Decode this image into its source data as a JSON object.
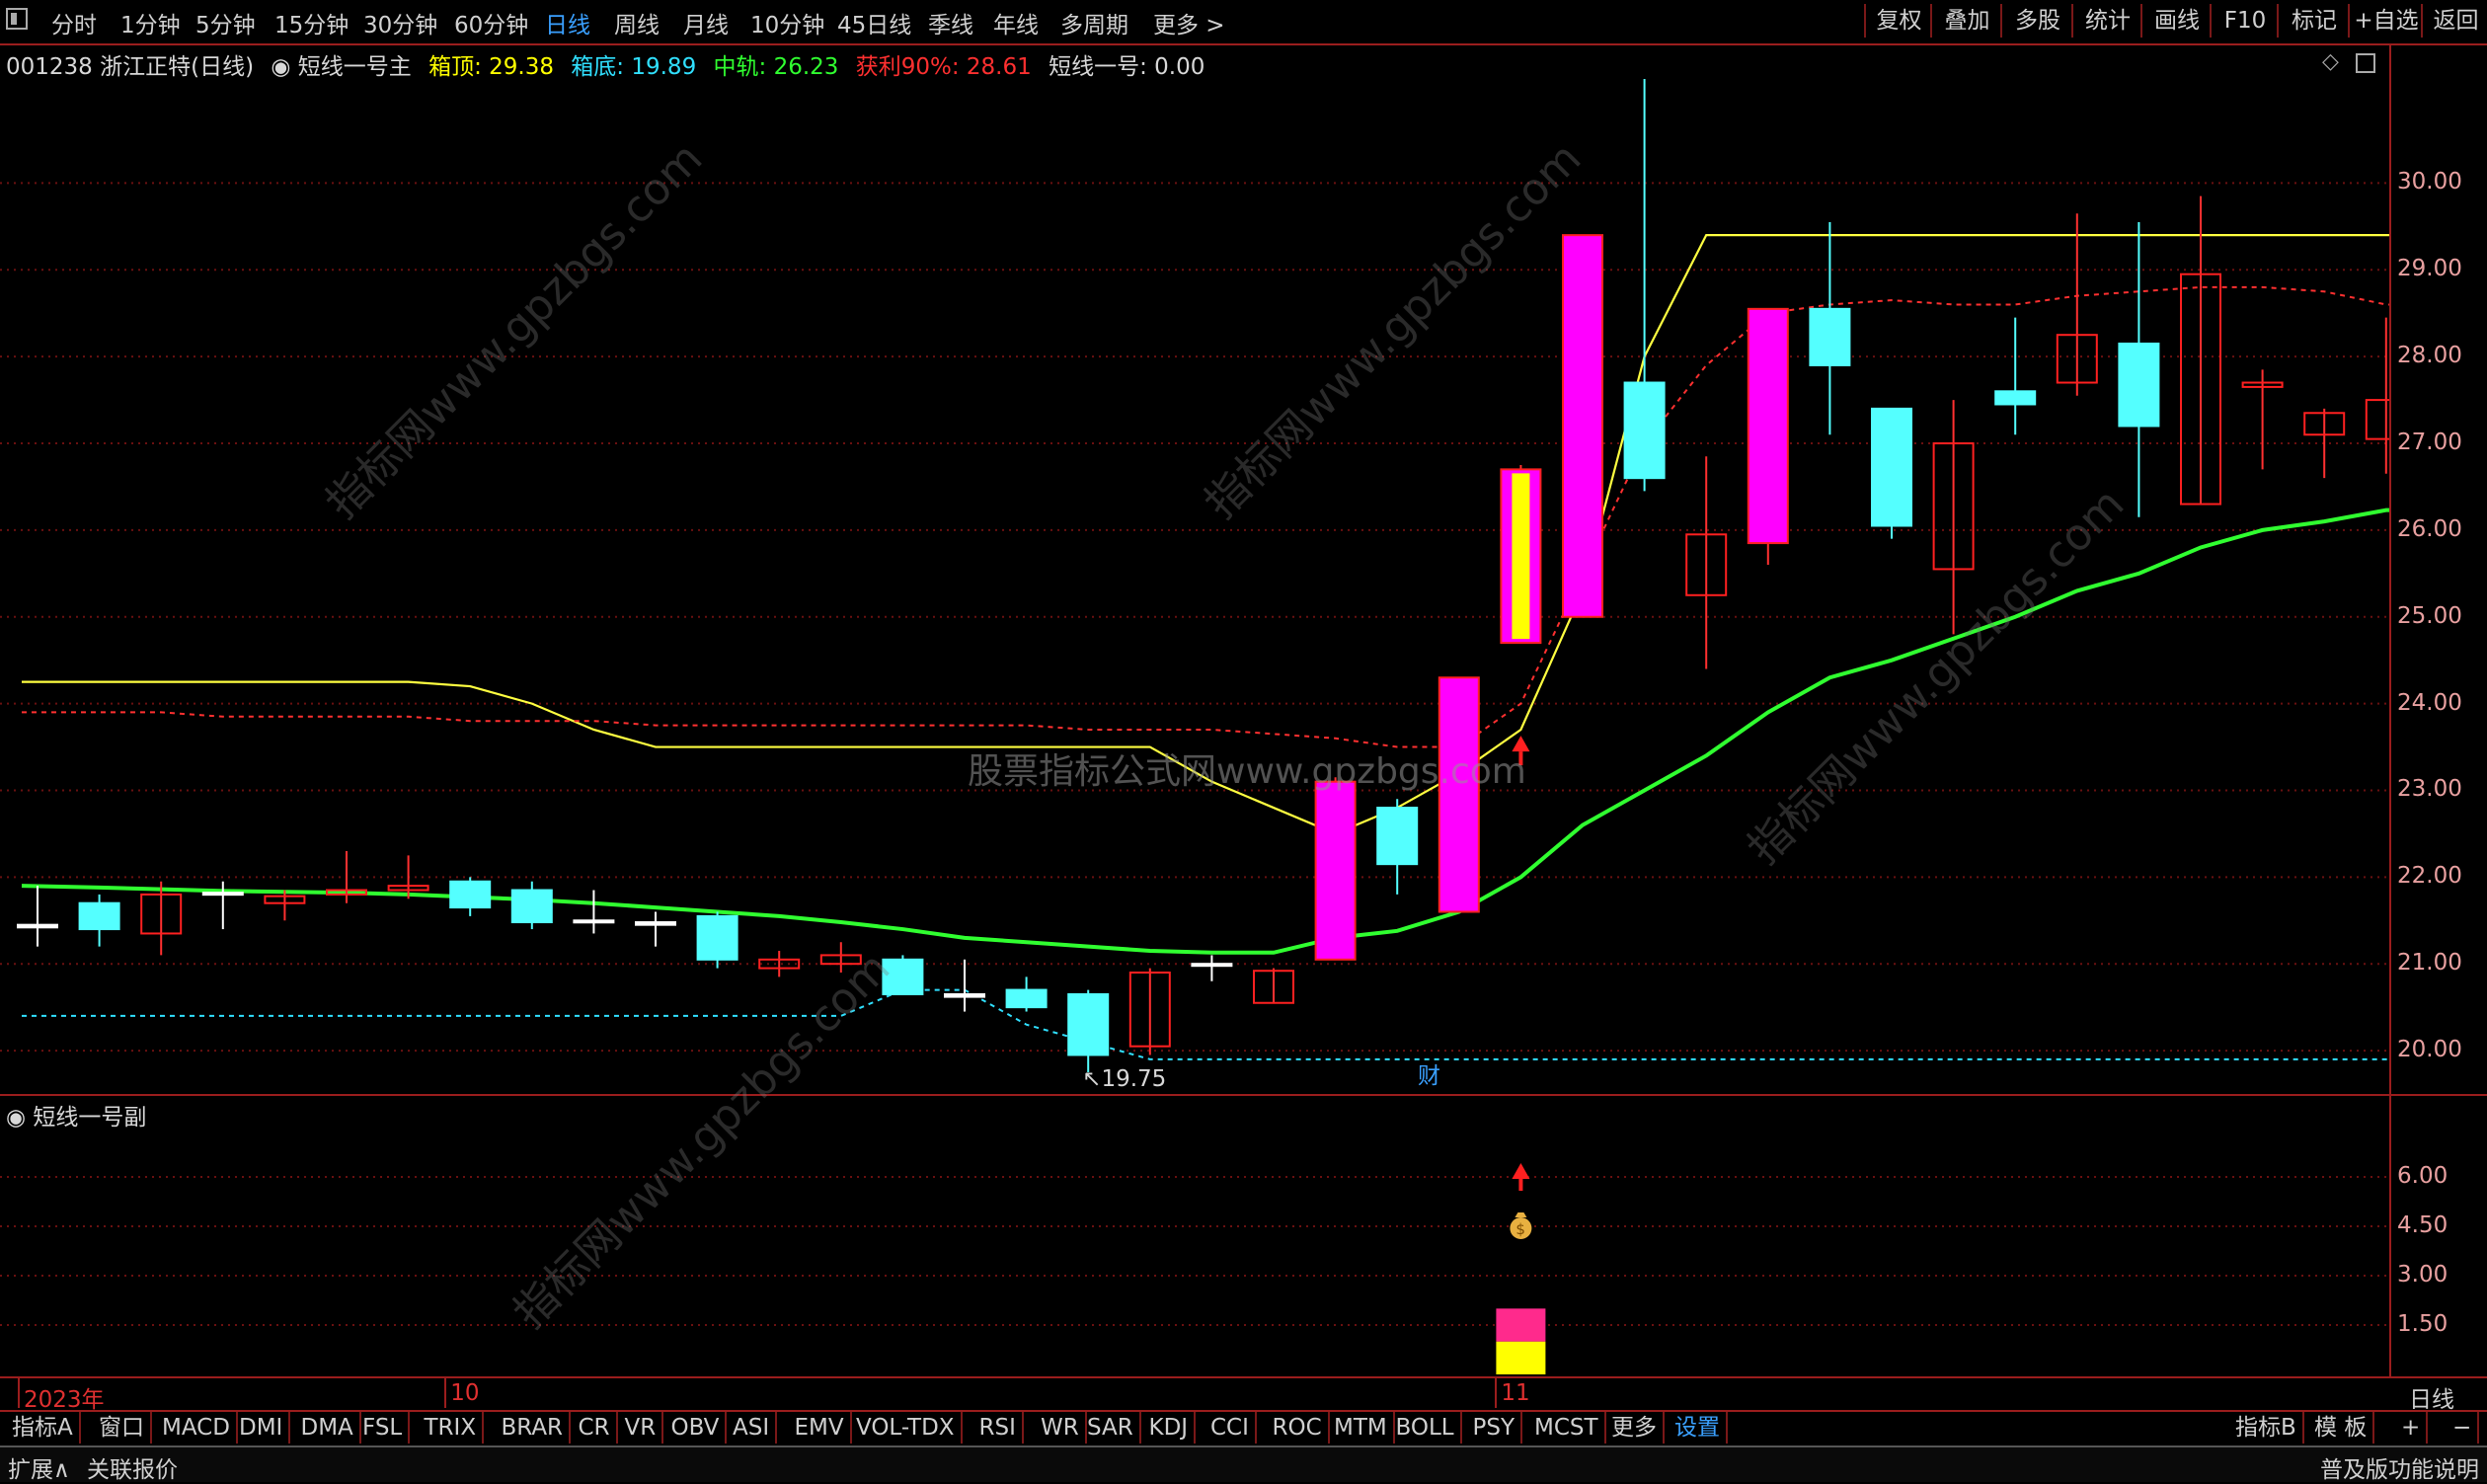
{
  "toolbar": {
    "periods": [
      "分时",
      "1分钟",
      "5分钟",
      "15分钟",
      "30分钟",
      "60分钟",
      "日线",
      "周线",
      "月线",
      "10分钟",
      "45日线",
      "季线",
      "年线",
      "多周期",
      "更多 >"
    ],
    "active": "日线",
    "right_buttons": [
      "复权",
      "叠加",
      "多股",
      "统计",
      "画线",
      "F10",
      "标记",
      "+自选",
      "返回"
    ]
  },
  "info": {
    "stock": "001238 浙江正特(日线)",
    "indicator": "短线一号主",
    "box_top_label": "箱顶: 29.38",
    "box_bottom_label": "箱底: 19.89",
    "mid_label": "中轨: 26.23",
    "profit_label": "获利90%: 28.61",
    "short_label": "短线一号: 0.00",
    "colors": {
      "box_top": "#ffff00",
      "box_bottom": "#30e0ff",
      "mid": "#30ff30",
      "profit": "#ff3030",
      "short": "#d8d8d8"
    }
  },
  "chart_data": {
    "type": "candlestick",
    "ylim": [
      19.5,
      31.2
    ],
    "yticks": [
      "30.00",
      "29.00",
      "28.00",
      "27.00",
      "26.00",
      "25.00",
      "24.00",
      "23.00",
      "22.00",
      "21.00",
      "20.00"
    ],
    "annotations": {
      "high": "31.55",
      "low": "19.75",
      "marker": "财"
    },
    "candles": [
      {
        "o": 21.42,
        "h": 21.9,
        "l": 21.2,
        "c": 21.45,
        "t": "doji"
      },
      {
        "o": 21.7,
        "h": 21.8,
        "l": 21.2,
        "c": 21.4,
        "t": "down"
      },
      {
        "o": 21.35,
        "h": 21.95,
        "l": 21.1,
        "c": 21.8,
        "t": "up"
      },
      {
        "o": 21.8,
        "h": 21.95,
        "l": 21.4,
        "c": 21.82,
        "t": "doji"
      },
      {
        "o": 21.7,
        "h": 21.85,
        "l": 21.5,
        "c": 21.78,
        "t": "up"
      },
      {
        "o": 21.8,
        "h": 22.3,
        "l": 21.7,
        "c": 21.85,
        "t": "up"
      },
      {
        "o": 21.85,
        "h": 22.25,
        "l": 21.75,
        "c": 21.9,
        "t": "up"
      },
      {
        "o": 21.95,
        "h": 22.0,
        "l": 21.55,
        "c": 21.65,
        "t": "down"
      },
      {
        "o": 21.85,
        "h": 21.95,
        "l": 21.4,
        "c": 21.48,
        "t": "down"
      },
      {
        "o": 21.5,
        "h": 21.85,
        "l": 21.35,
        "c": 21.48,
        "t": "doji"
      },
      {
        "o": 21.48,
        "h": 21.6,
        "l": 21.2,
        "c": 21.45,
        "t": "doji"
      },
      {
        "o": 21.55,
        "h": 21.6,
        "l": 20.95,
        "c": 21.05,
        "t": "down"
      },
      {
        "o": 20.95,
        "h": 21.15,
        "l": 20.85,
        "c": 21.05,
        "t": "up"
      },
      {
        "o": 21.0,
        "h": 21.25,
        "l": 20.9,
        "c": 21.1,
        "t": "up"
      },
      {
        "o": 21.05,
        "h": 21.1,
        "l": 20.65,
        "c": 20.65,
        "t": "down"
      },
      {
        "o": 20.65,
        "h": 21.05,
        "l": 20.45,
        "c": 20.62,
        "t": "doji"
      },
      {
        "o": 20.7,
        "h": 20.85,
        "l": 20.45,
        "c": 20.5,
        "t": "down"
      },
      {
        "o": 20.65,
        "h": 20.7,
        "l": 19.75,
        "c": 19.95,
        "t": "down"
      },
      {
        "o": 20.05,
        "h": 20.95,
        "l": 19.95,
        "c": 20.9,
        "t": "up"
      },
      {
        "o": 20.98,
        "h": 21.1,
        "l": 20.8,
        "c": 21.0,
        "t": "doji"
      },
      {
        "o": 20.55,
        "h": 20.95,
        "l": 20.55,
        "c": 20.92,
        "t": "up"
      },
      {
        "o": 21.05,
        "h": 23.15,
        "l": 21.05,
        "c": 23.1,
        "t": "limit"
      },
      {
        "o": 22.8,
        "h": 22.9,
        "l": 21.8,
        "c": 22.15,
        "t": "down"
      },
      {
        "o": 21.6,
        "h": 24.3,
        "l": 21.6,
        "c": 24.3,
        "t": "limit"
      },
      {
        "o": 24.7,
        "h": 26.75,
        "l": 24.7,
        "c": 26.7,
        "t": "limit2"
      },
      {
        "o": 25.0,
        "h": 29.4,
        "l": 25.0,
        "c": 29.4,
        "t": "limit"
      },
      {
        "o": 27.7,
        "h": 31.55,
        "l": 26.45,
        "c": 26.6,
        "t": "down"
      },
      {
        "o": 25.25,
        "h": 26.85,
        "l": 24.4,
        "c": 25.95,
        "t": "up"
      },
      {
        "o": 25.85,
        "h": 28.55,
        "l": 25.6,
        "c": 28.55,
        "t": "limit"
      },
      {
        "o": 28.55,
        "h": 29.55,
        "l": 27.1,
        "c": 27.9,
        "t": "down"
      },
      {
        "o": 27.4,
        "h": 27.4,
        "l": 25.9,
        "c": 26.05,
        "t": "down"
      },
      {
        "o": 25.55,
        "h": 27.5,
        "l": 24.8,
        "c": 27.0,
        "t": "up"
      },
      {
        "o": 27.6,
        "h": 28.45,
        "l": 27.1,
        "c": 27.45,
        "t": "down"
      },
      {
        "o": 27.7,
        "h": 29.65,
        "l": 27.55,
        "c": 28.25,
        "t": "up"
      },
      {
        "o": 28.15,
        "h": 29.55,
        "l": 26.15,
        "c": 27.2,
        "t": "down"
      },
      {
        "o": 26.3,
        "h": 29.85,
        "l": 26.3,
        "c": 28.95,
        "t": "up"
      },
      {
        "o": 27.65,
        "h": 27.85,
        "l": 26.7,
        "c": 27.7,
        "t": "up"
      },
      {
        "o": 27.1,
        "h": 27.4,
        "l": 26.6,
        "c": 27.35,
        "t": "up"
      },
      {
        "o": 27.05,
        "h": 28.45,
        "l": 26.65,
        "c": 27.5,
        "t": "up"
      }
    ],
    "series": [
      {
        "name": "箱顶",
        "style": "yellow-line",
        "values": [
          24.25,
          24.25,
          24.25,
          24.25,
          24.25,
          24.25,
          24.25,
          24.2,
          24.0,
          23.7,
          23.5,
          23.5,
          23.5,
          23.5,
          23.5,
          23.5,
          23.5,
          23.5,
          23.5,
          23.1,
          22.8,
          22.5,
          22.8,
          23.2,
          23.7,
          25.3,
          28.0,
          29.4,
          29.4,
          29.4,
          29.4,
          29.4,
          29.4,
          29.4,
          29.4,
          29.4,
          29.4,
          29.4,
          29.4
        ]
      },
      {
        "name": "箱底",
        "style": "cyan-dashed",
        "values": [
          20.4,
          20.4,
          20.4,
          20.4,
          20.4,
          20.4,
          20.4,
          20.4,
          20.4,
          20.4,
          20.4,
          20.4,
          20.4,
          20.4,
          20.7,
          20.7,
          20.3,
          20.1,
          19.9,
          19.9,
          19.9,
          19.9,
          19.9,
          19.9,
          19.9,
          19.9,
          19.9,
          19.9,
          19.9,
          19.9,
          19.9,
          19.9,
          19.9,
          19.9,
          19.9,
          19.9,
          19.9,
          19.9,
          19.9
        ]
      },
      {
        "name": "获利90%",
        "style": "red-dashed",
        "values": [
          23.9,
          23.9,
          23.9,
          23.85,
          23.85,
          23.85,
          23.85,
          23.8,
          23.8,
          23.8,
          23.75,
          23.75,
          23.75,
          23.75,
          23.75,
          23.75,
          23.75,
          23.7,
          23.7,
          23.7,
          23.65,
          23.6,
          23.5,
          23.5,
          24.0,
          25.5,
          27.0,
          27.9,
          28.5,
          28.6,
          28.65,
          28.6,
          28.6,
          28.7,
          28.75,
          28.8,
          28.8,
          28.75,
          28.6
        ]
      },
      {
        "name": "中轨",
        "style": "green-line",
        "values": [
          21.9,
          21.88,
          21.86,
          21.84,
          21.83,
          21.82,
          21.8,
          21.77,
          21.74,
          21.7,
          21.65,
          21.6,
          21.55,
          21.48,
          21.4,
          21.3,
          21.25,
          21.2,
          21.15,
          21.13,
          21.13,
          21.3,
          21.38,
          21.6,
          22.0,
          22.6,
          23.0,
          23.4,
          23.9,
          24.3,
          24.5,
          24.75,
          25.0,
          25.3,
          25.5,
          25.8,
          26.0,
          26.1,
          26.23
        ]
      }
    ],
    "signal_arrow_index": 24
  },
  "sub": {
    "title": "短线一号副",
    "yticks": [
      "6.00",
      "4.50",
      "3.00",
      "1.50"
    ],
    "ylim": [
      0,
      7.5
    ],
    "bar_index": 24,
    "bars": [
      {
        "from": 0,
        "to": 1,
        "color": "#ffff00"
      },
      {
        "from": 1,
        "to": 2,
        "color": "#ff2a8c"
      }
    ],
    "moneybag_value": 4.5,
    "arrow_value": 6.0
  },
  "dates": [
    {
      "label": "2023年",
      "idx": 0
    },
    {
      "label": "10",
      "idx": 7
    },
    {
      "label": "11",
      "idx": 24
    }
  ],
  "date_right": "日线",
  "indicators": [
    "指标A",
    "窗口",
    "MACD",
    "DMI",
    "DMA",
    "FSL",
    "TRIX",
    "BRAR",
    "CR",
    "VR",
    "OBV",
    "ASI",
    "EMV",
    "VOL-TDX",
    "RSI",
    "WR",
    "SAR",
    "KDJ",
    "CCI",
    "ROC",
    "MTM",
    "BOLL",
    "PSY",
    "MCST",
    "更多"
  ],
  "indicator_settings": "设置",
  "indicator_right": [
    "指标B",
    "模 板",
    "+",
    "−"
  ],
  "bottom": {
    "left": [
      "扩展∧",
      "关联报价"
    ],
    "right": "普及版功能说明"
  },
  "watermarks": [
    "股票指标公式网www.gpzbgs.com",
    "指标网www.gpzbgs.com"
  ]
}
